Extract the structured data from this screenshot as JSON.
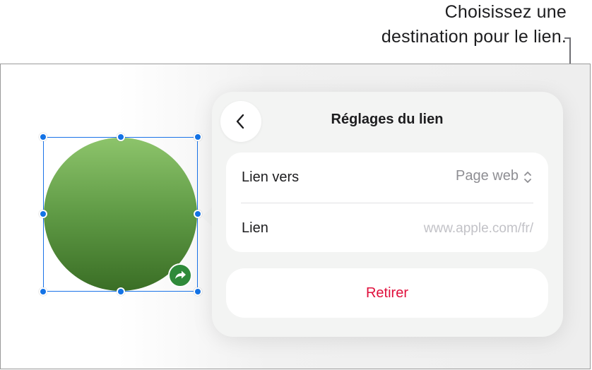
{
  "callout": {
    "line1": "Choisissez une",
    "line2": "destination pour le lien."
  },
  "popover": {
    "title": "Réglages du lien",
    "back_icon": "chevron-left-icon",
    "rows": [
      {
        "label": "Lien vers",
        "value": "Page web",
        "icon": "chevron-up-down-icon"
      },
      {
        "label": "Lien",
        "placeholder": "www.apple.com/fr/"
      }
    ],
    "remove_label": "Retirer"
  },
  "shape": {
    "type": "circle",
    "fill_top": "#8dc46b",
    "fill_bottom": "#3a6e25",
    "badge_icon": "link-arrow-icon",
    "badge_color": "#2f8a3a"
  },
  "colors": {
    "selection": "#1473e6",
    "destructive": "#e0103c"
  }
}
